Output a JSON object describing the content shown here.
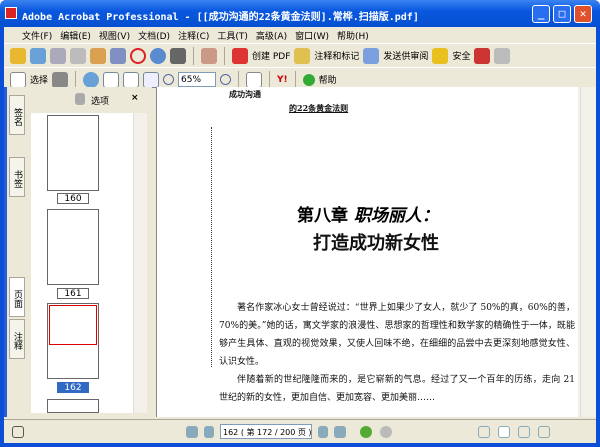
{
  "window": {
    "title": "Adobe Acrobat Professional - [[成功沟通的22条黄金法则].常桦.扫描版.pdf]",
    "minimize": "_",
    "maximize": "□",
    "close": "✕"
  },
  "menu": [
    "文件(F)",
    "编辑(E)",
    "视图(V)",
    "文档(D)",
    "注释(C)",
    "工具(T)",
    "高级(A)",
    "窗口(W)",
    "帮助(H)"
  ],
  "toolbar1": {
    "create_pdf": "创建 PDF",
    "comment": "注释和标记",
    "send_review": "发送供审阅",
    "security": "安全"
  },
  "toolbar2": {
    "select": "选择",
    "zoom": "65%",
    "help": "帮助",
    "yahoo": "Y!"
  },
  "sidebar": {
    "tabs": [
      "签名",
      "书签",
      "页面",
      "注释"
    ],
    "options": "选项",
    "close": "×",
    "pages": [
      "160",
      "161",
      "162"
    ],
    "selected_page": "162"
  },
  "page": {
    "header_left": "成功沟通",
    "header_right": "的22条黄金法则",
    "chapter": "第八章",
    "chapter_title": "职场丽人：",
    "subtitle": "打造成功新女性",
    "paragraphs": [
      "著名作家冰心女士曾经说过：“世界上如果少了女人，就少了 50%的真，60%的善，70%的美。”她的话，寓文学家的浪漫性、思想家的哲理性和数学家的精确性于一体，既能够产生具体、直观的视觉效果，又使人回味不绝，在细细的品尝中去更深刻地感觉女性、认识女性。",
      "伴随着新的世纪隆隆而来的，是它崭新的气息。经过了又一个百年的历练，走向 21 世纪的新的女性，更加自信、更加宽容、更加美丽……"
    ]
  },
  "status": {
    "page_field": "162 ( 第 172 / 200 页 )"
  }
}
